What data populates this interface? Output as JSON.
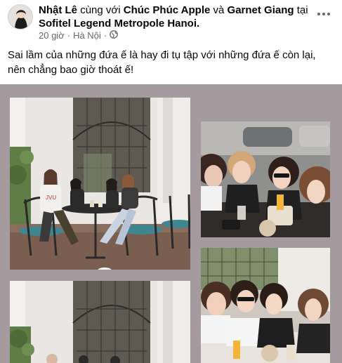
{
  "post": {
    "author": "Nhật Lê",
    "with_word": "cùng với",
    "tagged_1": "Chúc Phúc Apple",
    "and_word": "và",
    "tagged_2": "Garnet Giang",
    "at_word": "tại",
    "location": "Sofitel Legend Metropole Hanoi.",
    "time": "20 giờ",
    "separator": "·",
    "place": "Hà Nội",
    "separator_2": "·",
    "privacy_icon": "globe-icon",
    "more_icon": "more-horizontal-icon",
    "text": "Sai lầm của những đứa ế là hay đi tụ tập với những đứa ế còn lại, nên chẳng bao giờ thoát ế!"
  },
  "media": {
    "background": "#a59b9e",
    "photos": [
      {
        "name": "cafe-terrace-group-photo",
        "caption": ""
      },
      {
        "name": "cafe-selfie-photo-1",
        "caption": ""
      },
      {
        "name": "cafe-terrace-photo-2",
        "caption": ""
      },
      {
        "name": "cafe-selfie-photo-2",
        "caption": ""
      }
    ],
    "printed_text": "JVU"
  },
  "colors": {
    "text_primary": "#050505",
    "text_secondary": "#65676b",
    "table_teal": "#3f8690"
  }
}
